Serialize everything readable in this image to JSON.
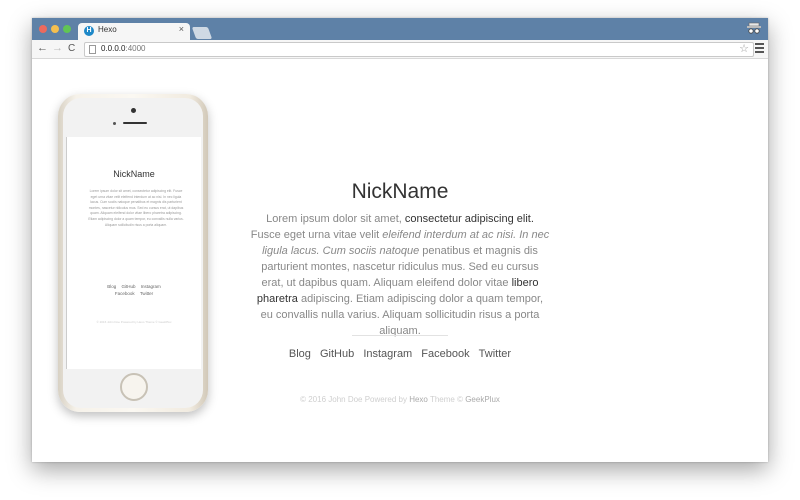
{
  "browser": {
    "tab_title": "Hexo",
    "tab_favicon_letter": "H",
    "url_host": "0.0.0.0",
    "url_port": ":4000",
    "accent": "#5e81a7"
  },
  "page": {
    "nickname": "NickName",
    "bio": {
      "p1": "Lorem ipsum dolor sit amet, ",
      "p2_strong": "consectetur adipiscing elit.",
      "p3": " Fusce eget urna vitae velit ",
      "p4_em": "eleifend interdum at ac nisi. In nec ligula lacus. Cum sociis natoque",
      "p5": " penatibus et magnis dis parturient montes, nascetur ridiculus mus. Sed eu cursus erat, ut dapibus quam. Aliquam eleifend dolor vitae ",
      "p6_strong": "libero pharetra",
      "p7": " adipiscing. Etiam adipiscing dolor a quam tempor, eu convallis nulla varius. Aliquam sollicitudin risus a porta aliquam."
    },
    "links": [
      "Blog",
      "GitHub",
      "Instagram",
      "Facebook",
      "Twitter"
    ],
    "footer": {
      "f1": "© 2016 John Doe Powered by ",
      "f2": "Hexo",
      "f3": " Theme © ",
      "f4": "GeekPlux"
    }
  },
  "phone_preview": {
    "nickname": "NickName",
    "bio": "Lorem ipsum dolor sit amet, consectetur adipiscing elit. Fusce eget urna vitae velit eleifend interdum at ac nisi. In nec ligula lacus. Cum sociis natoque penatibus et magnis dis parturient montes, nascetur ridiculus mus. Sed eu cursus erat, ut dapibus quam. Aliquam eleifend dolor vitae libero pharetra adipiscing. Etiam adipiscing dolor a quam tempor, eu convallis nulla varius. Aliquam sollicitudin risus a porta aliquam.",
    "links_row1": [
      "Blog",
      "GitHub",
      "Instagram"
    ],
    "links_row2": [
      "Facebook",
      "Twitter"
    ],
    "footer": "© 2016 John Doe Powered by Hexo Theme © GeekPlux"
  }
}
